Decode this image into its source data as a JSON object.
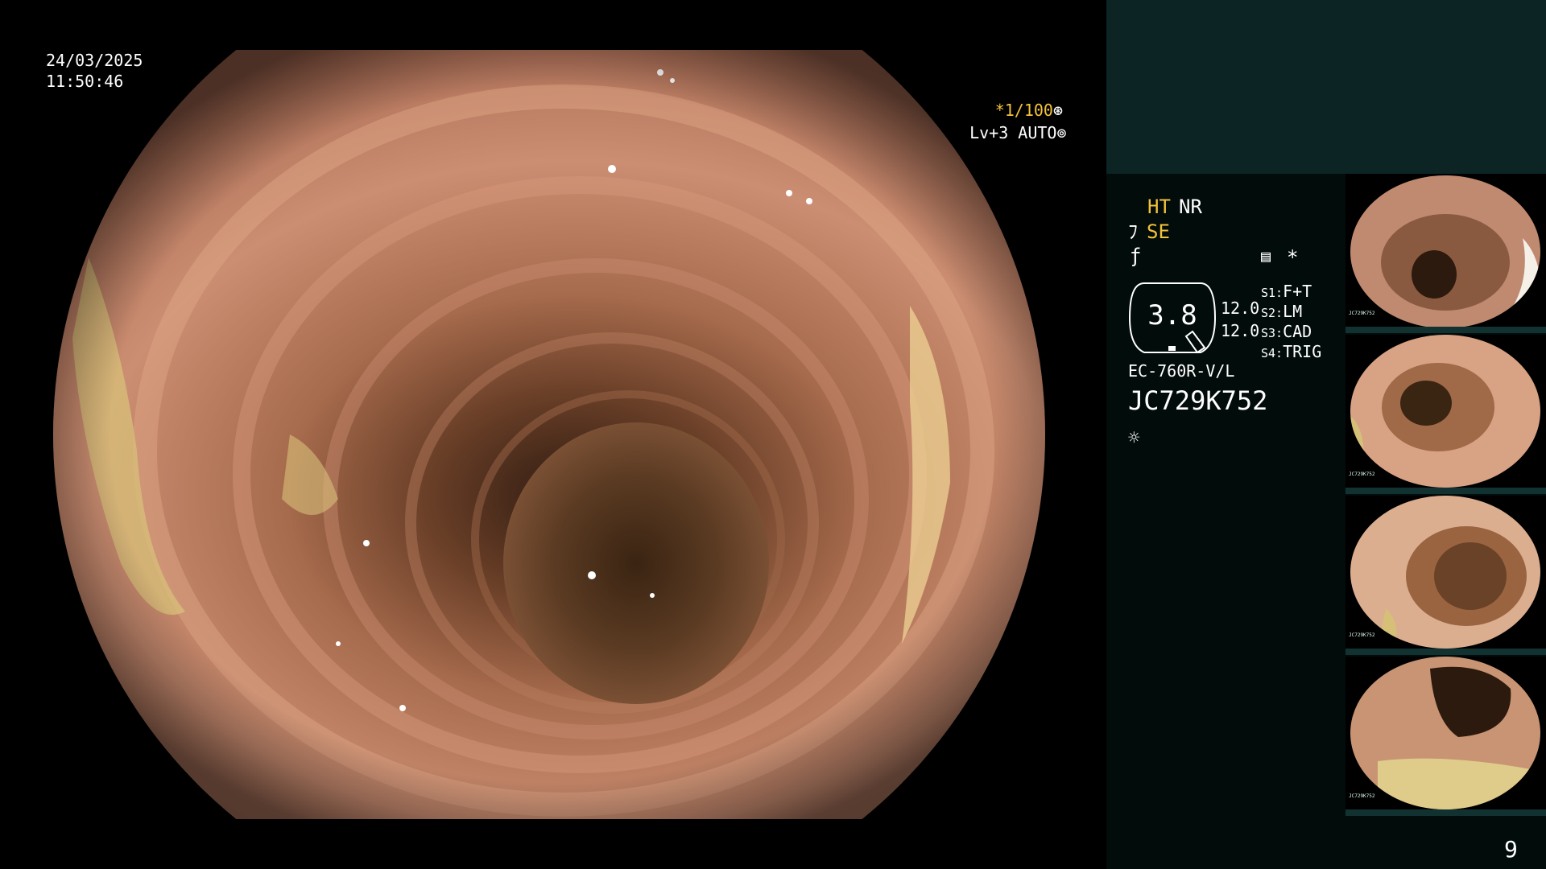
{
  "overlay": {
    "date": "24/03/2025",
    "time": "11:50:46",
    "shutter": "*1/100",
    "level": "Lv+3 AUTO"
  },
  "panel": {
    "ht": "HT",
    "nr": "NR",
    "se": "SE",
    "scope_value": "3.8",
    "value_a": "12.0",
    "value_b": "12.0",
    "s1_key": "S1:",
    "s1_val": "F+T",
    "s2_key": "S2:",
    "s2_val": "LM",
    "s3_key": "S3:",
    "s3_val": "CAD",
    "s4_key": "S4:",
    "s4_val": "TRIG",
    "scope_model": "EC-760R-V/L",
    "serial": "JC729K752"
  },
  "thumbnails": [
    {
      "label": "JC729K752"
    },
    {
      "label": "JC729K752"
    },
    {
      "label": "JC729K752"
    },
    {
      "label": "JC729K752"
    }
  ],
  "page_number": "9",
  "colors": {
    "accent_yellow": "#f4c23a",
    "panel_top": "#0c2423",
    "panel_bg": "#020c0b"
  },
  "icons": [
    "shutter-wheel-icon",
    "auto-iris-icon",
    "enhance-icon",
    "freeze-icon",
    "menu-icon",
    "star-icon",
    "light-icon"
  ]
}
